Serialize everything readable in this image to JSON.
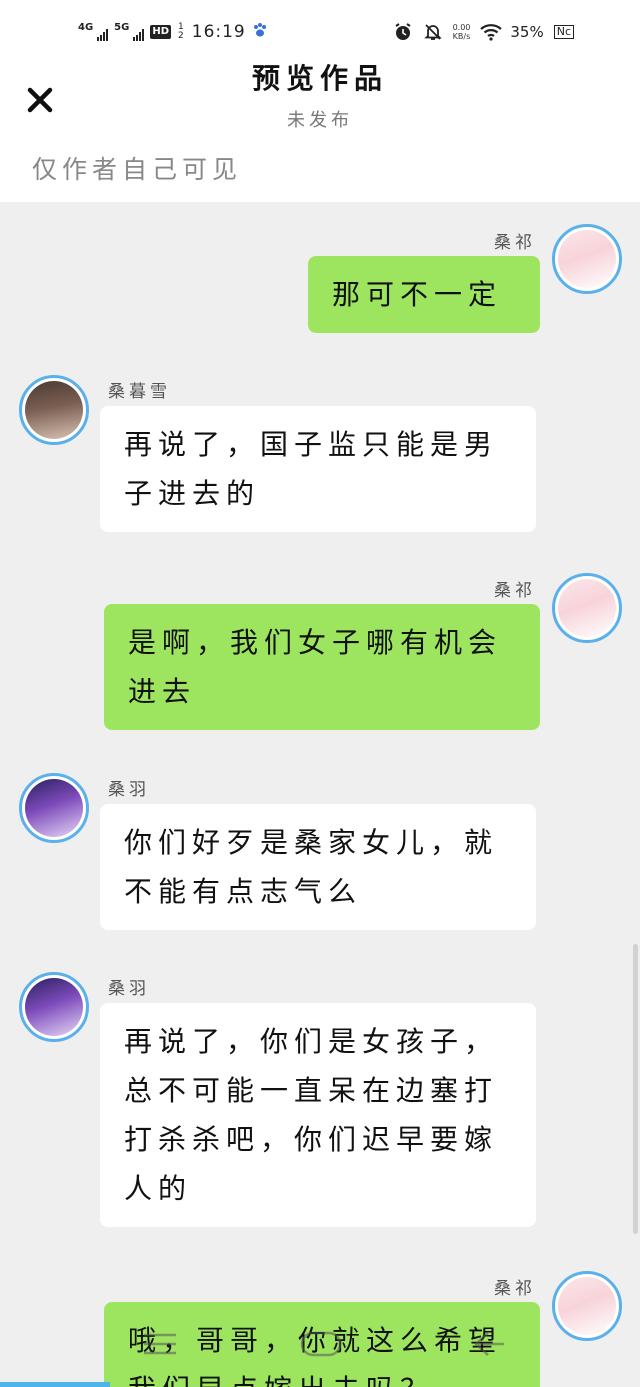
{
  "status_bar": {
    "signal_1": "4G",
    "signal_2": "5G",
    "hd_badge": "HD",
    "hd_num_top": "1",
    "hd_num_bottom": "2",
    "time": "16:19",
    "net_speed_value": "0.00",
    "net_speed_unit": "KB/s",
    "battery": "35%",
    "nfc": "Nc"
  },
  "header": {
    "title": "预览作品",
    "subtitle": "未发布",
    "visibility_note": "仅作者自己可见"
  },
  "messages": [
    {
      "side": "right",
      "sender": "桑祁",
      "text": "那可不一定",
      "avatar": "girl-avatar"
    },
    {
      "side": "left",
      "sender": "桑暮雪",
      "text": "再说了，国子监只能是男子进去的",
      "avatar": "woman-avatar"
    },
    {
      "side": "right",
      "sender": "桑祁",
      "text": "是啊，我们女子哪有机会进去",
      "avatar": "girl-avatar"
    },
    {
      "side": "left",
      "sender": "桑羽",
      "text": "你们好歹是桑家女儿，就不能有点志气么",
      "avatar": "boy-avatar"
    },
    {
      "side": "left",
      "sender": "桑羽",
      "text": "再说了，你们是女孩子，总不可能一直呆在边塞打打杀杀吧，你们迟早要嫁人的",
      "avatar": "boy-avatar"
    },
    {
      "side": "right",
      "sender": "桑祁",
      "text": "哦，哥哥，你就这么希望我们早点嫁出去吗？",
      "avatar": "girl-avatar"
    }
  ],
  "colors": {
    "own_bubble": "#9ee55f",
    "other_bubble": "#ffffff",
    "avatar_ring": "#5ab0ea",
    "background": "#efefef"
  }
}
